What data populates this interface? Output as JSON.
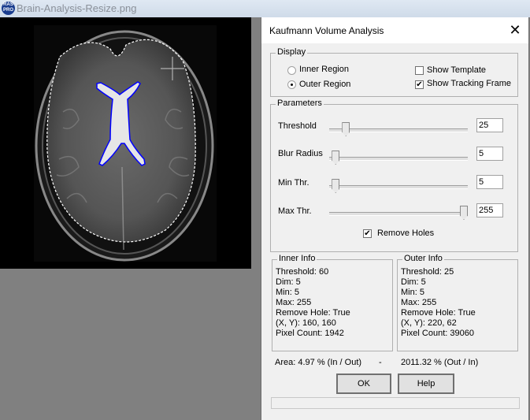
{
  "window": {
    "title": "Brain-Analysis-Resize.png",
    "app_icon": "raspro-icon",
    "app_icon_text": [
      "RAS",
      "PRO"
    ]
  },
  "image": {
    "description": "Axial brain MRI with inner (blue) ventricle contour and outer (white dashed) brain contour",
    "inner_contour_color": "#0000ff",
    "outer_contour_color": "#ffffff"
  },
  "dialog": {
    "title": "Kaufmann Volume Analysis",
    "close_icon": "close-icon",
    "display": {
      "label": "Display",
      "inner_region": {
        "label": "Inner Region",
        "checked": false
      },
      "outer_region": {
        "label": "Outer Region",
        "checked": true
      },
      "show_template": {
        "label": "Show Template",
        "checked": false
      },
      "show_tracking_frame": {
        "label": "Show Tracking Frame",
        "checked": true
      }
    },
    "parameters": {
      "label": "Parameters",
      "sliders": [
        {
          "label": "Threshold",
          "value": "25",
          "min": 0,
          "max": 255,
          "position": 25
        },
        {
          "label": "Blur Radius",
          "value": "5",
          "min": 0,
          "max": 255,
          "position": 5
        },
        {
          "label": "Min Thr.",
          "value": "5",
          "min": 0,
          "max": 255,
          "position": 5
        },
        {
          "label": "Max Thr.",
          "value": "255",
          "min": 0,
          "max": 255,
          "position": 255
        }
      ],
      "remove_holes": {
        "label": "Remove Holes",
        "checked": true
      }
    },
    "inner_info": {
      "label": "Inner Info",
      "lines": [
        "Threshold: 60",
        "Dim: 5",
        "Min: 5",
        "Max: 255",
        "Remove Hole: True",
        "(X, Y): 160, 160",
        "Pixel Count: 1942"
      ]
    },
    "outer_info": {
      "label": "Outer Info",
      "lines": [
        "Threshold: 25",
        "Dim: 5",
        "Min: 5",
        "Max: 255",
        "Remove Hole: True",
        "(X, Y): 220, 62",
        "Pixel Count: 39060"
      ]
    },
    "area": {
      "left": "Area: 4.97 % (In / Out)",
      "separator": "-",
      "right": "2011.32 % (Out / In)"
    },
    "ok_label": "OK",
    "help_label": "Help",
    "status": ""
  }
}
